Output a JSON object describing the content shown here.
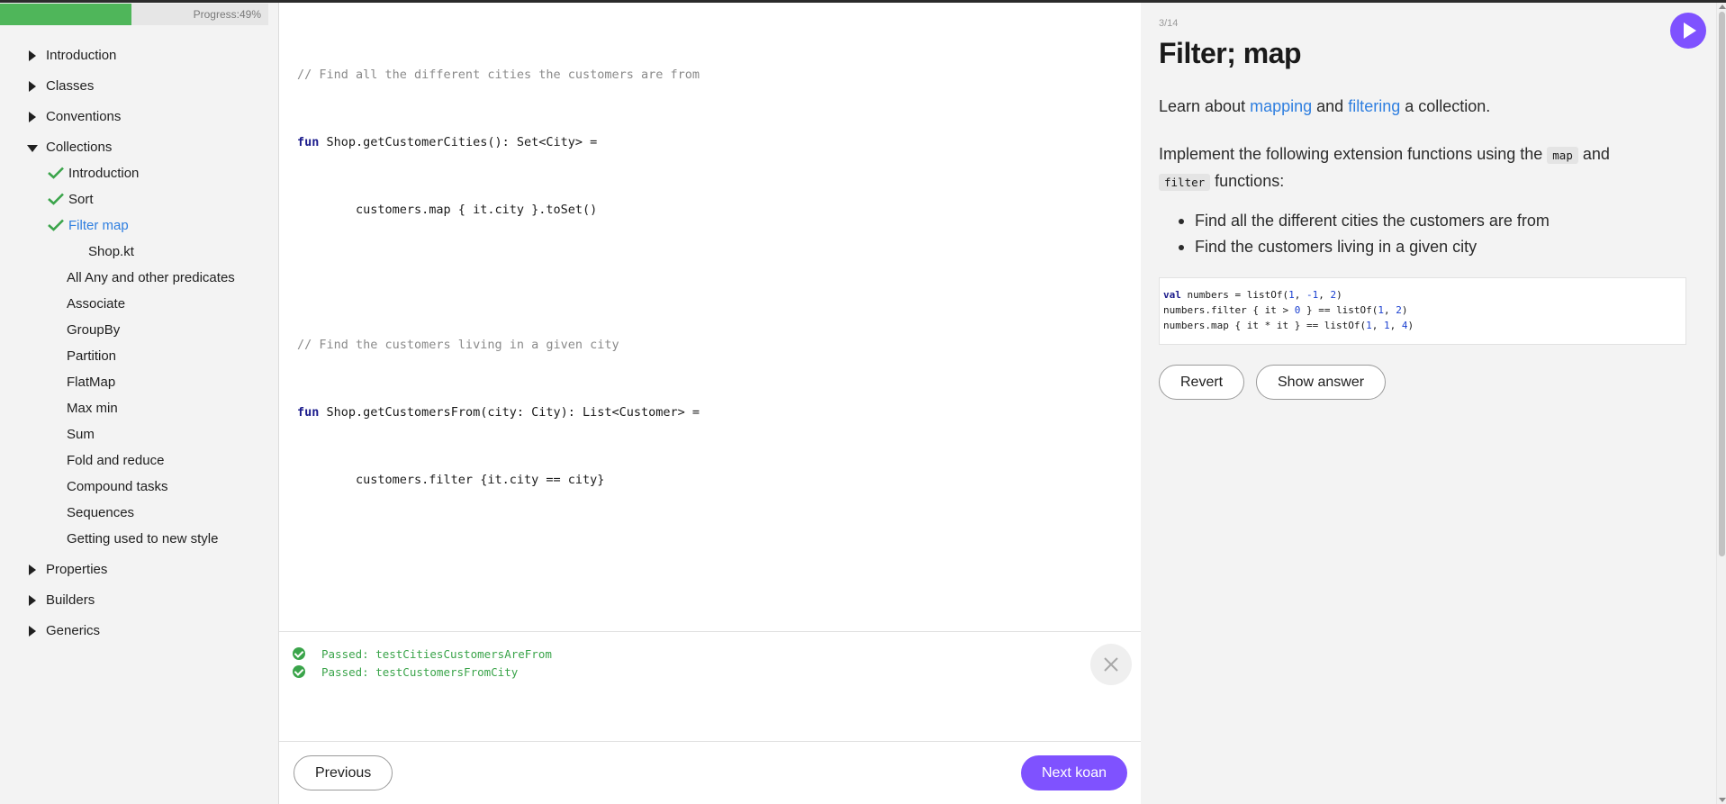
{
  "progress": {
    "label": "Progress:",
    "percent_text": "49%",
    "fraction": 0.49
  },
  "sidebar": {
    "sections": [
      {
        "label": "Introduction",
        "expanded": false
      },
      {
        "label": "Classes",
        "expanded": false
      },
      {
        "label": "Conventions",
        "expanded": false
      },
      {
        "label": "Collections",
        "expanded": true
      },
      {
        "label": "Properties",
        "expanded": false
      },
      {
        "label": "Builders",
        "expanded": false
      },
      {
        "label": "Generics",
        "expanded": false
      }
    ],
    "collections_items": [
      {
        "label": "Introduction",
        "done": true
      },
      {
        "label": "Sort",
        "done": true
      },
      {
        "label": "Filter map",
        "done": true,
        "active": true
      },
      {
        "label": "Shop.kt",
        "file": true
      },
      {
        "label": "All Any and other predicates"
      },
      {
        "label": "Associate"
      },
      {
        "label": "GroupBy"
      },
      {
        "label": "Partition"
      },
      {
        "label": "FlatMap"
      },
      {
        "label": "Max min"
      },
      {
        "label": "Sum"
      },
      {
        "label": "Fold and reduce"
      },
      {
        "label": "Compound tasks"
      },
      {
        "label": "Sequences"
      },
      {
        "label": "Getting used to new style"
      }
    ]
  },
  "editor": {
    "lines": [
      {
        "comment": "// Find all the different cities the customers are from"
      },
      {
        "kw": "fun",
        "text": " Shop.getCustomerCities(): Set<City> ="
      },
      {
        "text": "        customers.map { it.city }.toSet()"
      },
      {
        "text": ""
      },
      {
        "comment": "// Find the customers living in a given city"
      },
      {
        "kw": "fun",
        "text": " Shop.getCustomersFrom(city: City): List<Customer> ="
      },
      {
        "text": "        customers.filter {it.city == city}"
      }
    ]
  },
  "results": [
    "Passed: testCitiesCustomersAreFrom",
    "Passed: testCustomersFromCity"
  ],
  "footer": {
    "previous_label": "Previous",
    "next_label": "Next koan"
  },
  "task": {
    "counter": "3/14",
    "title": "Filter; map",
    "intro": {
      "pre": "Learn about ",
      "link1": "mapping",
      "mid": " and ",
      "link2": "filtering",
      "post": " a collection."
    },
    "instruction": {
      "pre": "Implement the following extension functions using the ",
      "code1": "map",
      "mid": " and",
      "code2": "filter",
      "post": " functions:"
    },
    "bullets": [
      "Find all the different cities the customers are from",
      "Find the customers living in a given city"
    ],
    "sample": {
      "line1": {
        "kw": "val",
        "rest": " numbers = listOf(",
        "n1": "1",
        "c1": ", ",
        "n2": "-1",
        "c2": ", ",
        "n3": "2",
        "end": ")"
      },
      "line2": {
        "a": "numbers.filter { it > ",
        "n1": "0",
        "b": " } == listOf(",
        "n2": "1",
        "c": ", ",
        "n3": "2",
        "end": ")"
      },
      "line3": {
        "a": "numbers.map { it * it } == listOf(",
        "n1": "1",
        "c1": ", ",
        "n2": "1",
        "c2": ", ",
        "n3": "4",
        "end": ")"
      }
    },
    "revert_label": "Revert",
    "show_answer_label": "Show answer"
  },
  "colors": {
    "accent": "#7f52ff",
    "link": "#2f7fe0",
    "success": "#3aa44a",
    "progress": "#4fb65a"
  },
  "icons": {
    "run": "play-icon",
    "close": "close-icon",
    "check": "check-icon",
    "expand": "triangle-right-icon",
    "collapse": "triangle-down-icon"
  }
}
